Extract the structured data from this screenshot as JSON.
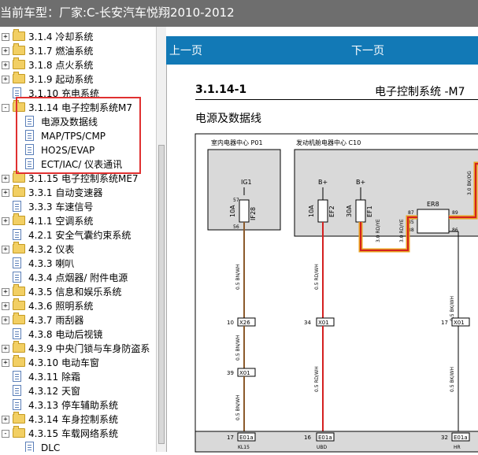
{
  "window": {
    "title": "当前车型：厂家:C-长安汽车悦翔2010-2012"
  },
  "tree": {
    "items": [
      {
        "label": "3.1.4 冷却系统",
        "type": "folder",
        "expander": "+"
      },
      {
        "label": "3.1.7 燃油系统",
        "type": "folder",
        "expander": "+"
      },
      {
        "label": "3.1.8 点火系统",
        "type": "folder",
        "expander": "+"
      },
      {
        "label": "3.1.9 起动系统",
        "type": "folder",
        "expander": "+"
      },
      {
        "label": "3.1.10 充电系统",
        "type": "doc",
        "expander": ""
      },
      {
        "label": "3.1.14 电子控制系统M7",
        "type": "folder",
        "expander": "-"
      },
      {
        "label": "电源及数据线",
        "type": "doc",
        "expander": ""
      },
      {
        "label": "MAP/TPS/CMP",
        "type": "doc",
        "expander": ""
      },
      {
        "label": "HO2S/EVAP",
        "type": "doc",
        "expander": ""
      },
      {
        "label": "ECT/IAC/ 仪表通讯",
        "type": "doc",
        "expander": ""
      },
      {
        "label": "3.1.15 电子控制系统ME7",
        "type": "folder",
        "expander": "+"
      },
      {
        "label": "3.3.1 自动变速器",
        "type": "folder",
        "expander": "+"
      },
      {
        "label": "3.3.3 车速信号",
        "type": "doc",
        "expander": ""
      },
      {
        "label": "4.1.1 空调系统",
        "type": "folder",
        "expander": "+"
      },
      {
        "label": "4.2.1 安全气囊约束系统",
        "type": "doc",
        "expander": ""
      },
      {
        "label": "4.3.2 仪表",
        "type": "folder",
        "expander": "+"
      },
      {
        "label": "4.3.3 喇叭",
        "type": "doc",
        "expander": ""
      },
      {
        "label": "4.3.4 点烟器/ 附件电源",
        "type": "doc",
        "expander": ""
      },
      {
        "label": "4.3.5 信息和娱乐系统",
        "type": "folder",
        "expander": "+"
      },
      {
        "label": "4.3.6 照明系统",
        "type": "folder",
        "expander": "+"
      },
      {
        "label": "4.3.7 雨刮器",
        "type": "folder",
        "expander": "+"
      },
      {
        "label": "4.3.8 电动后视镜",
        "type": "doc",
        "expander": ""
      },
      {
        "label": "4.3.9 中央门锁与车身防盗系",
        "type": "folder",
        "expander": "+"
      },
      {
        "label": "4.3.10 电动车窗",
        "type": "folder",
        "expander": "+"
      },
      {
        "label": "4.3.11 除霜",
        "type": "doc",
        "expander": ""
      },
      {
        "label": "4.3.12 天窗",
        "type": "doc",
        "expander": ""
      },
      {
        "label": "4.3.13 停车辅助系统",
        "type": "doc",
        "expander": ""
      },
      {
        "label": "4.3.14 车身控制系统",
        "type": "folder",
        "expander": "+"
      },
      {
        "label": "4.3.15 车载网络系统",
        "type": "folder",
        "expander": "-"
      },
      {
        "label": "DLC",
        "type": "doc",
        "expander": ""
      }
    ]
  },
  "nav": {
    "prev": "上一页",
    "next": "下一页"
  },
  "doc": {
    "page_num": "3.1.14-1",
    "system_title": "电子控制系统 -M7",
    "section_title": "电源及数据线",
    "box1_title": "室内电器中心 P01",
    "box2_title": "发动机舱电器中心 C10",
    "ig1": "IG1",
    "bplus1": "B+",
    "bplus2": "B+",
    "pin57": "57",
    "pin56": "56",
    "fuse1_rating": "10A",
    "fuse1_name": "IF28",
    "fuse2_rating": "10A",
    "fuse2_name": "EF2",
    "fuse3_rating": "30A",
    "fuse3_name": "EF1",
    "relay_name": "ER8",
    "relay_pin87": "87",
    "relay_pin85": "85",
    "relay_pin89": "89",
    "relay_pin88": "88",
    "relay_pin86": "86",
    "wire1": "0.5 BN/WH",
    "wire2": "0.5 RD/WH",
    "wire3": "3.0 RD/YE",
    "wire4": "0.5 BK/WH",
    "wire5": "3.0 BK/OG",
    "wire6": "3.0 RD/YE",
    "wire7": "0.5 BN/WH",
    "wire8": "0.5 BN/WH",
    "wire9": "0.5 RD/WH",
    "wire10": "0.5 BK/WH",
    "conn1_num": "10",
    "conn1_name": "X26",
    "conn2_num": "34",
    "conn2_name": "X01",
    "conn3_num": "17",
    "conn3_name": "X01",
    "conn4_num": "39",
    "conn4_name": "X01",
    "bottom1_num": "17",
    "bottom1_name": "E01a",
    "bottom1_sig": "KL15",
    "bottom2_num": "16",
    "bottom2_name": "E01a",
    "bottom2_sig": "UBD",
    "bottom3_num": "32",
    "bottom3_name": "E01a",
    "bottom3_sig": "HR"
  },
  "colors": {
    "nav_blue": "#1279b6",
    "highlight_red": "#e03030",
    "titlebar_gray": "#6e6e6e"
  }
}
